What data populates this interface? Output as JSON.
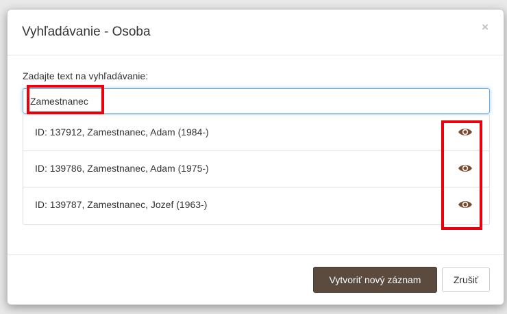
{
  "modal": {
    "title": "Vyhľadávanie - Osoba",
    "close_label": "×"
  },
  "search": {
    "label": "Zadajte text na vyhľadávanie:",
    "value": "Zamestnanec"
  },
  "results": [
    {
      "text": "ID: 137912, Zamestnanec, Adam (1984-)",
      "icon": "eye-icon"
    },
    {
      "text": "ID: 139786, Zamestnanec, Adam (1975-)",
      "icon": "eye-icon"
    },
    {
      "text": "ID: 139787, Zamestnanec, Jozef (1963-)",
      "icon": "eye-icon"
    }
  ],
  "footer": {
    "create_label": "Vytvoriť nový záznam",
    "cancel_label": "Zrušiť"
  },
  "colors": {
    "primary_button": "#5b4b3f",
    "highlight": "#e8000b",
    "input_focus": "#66afe9",
    "eye_icon": "#7b4a2e"
  }
}
